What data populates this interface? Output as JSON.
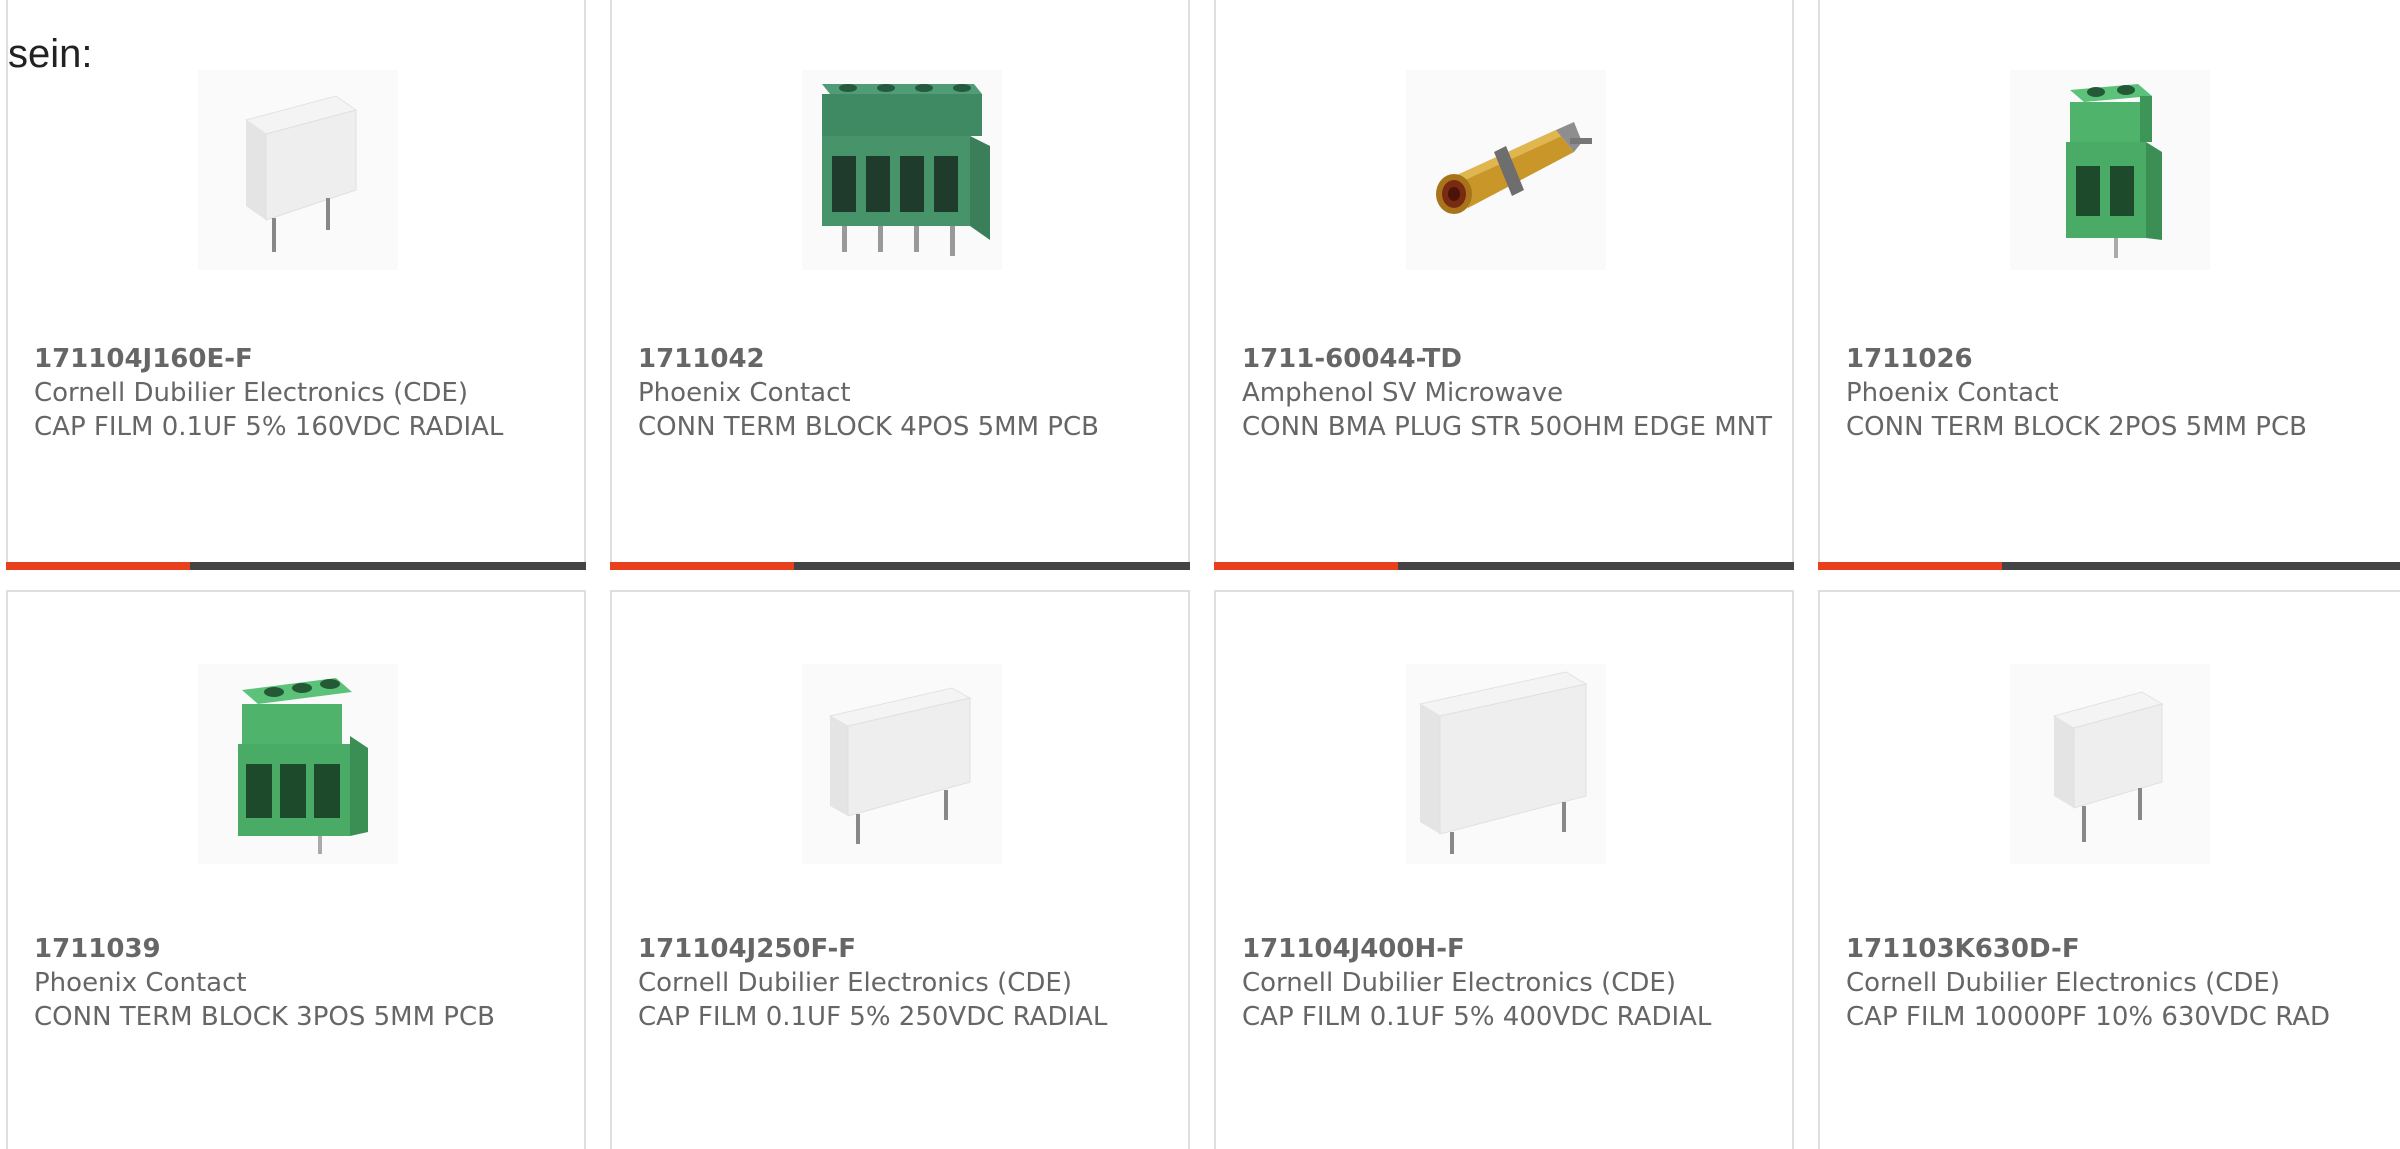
{
  "intro_text": "sein:",
  "colors": {
    "accent": "#e8401c",
    "bar_dark": "#444444",
    "card_border": "#dedede",
    "text": "#666666"
  },
  "products": [
    {
      "part_number": "171104J160E-F",
      "manufacturer": "Cornell Dubilier Electronics (CDE)",
      "description": "CAP FILM 0.1UF 5% 160VDC RADIAL",
      "image_icon": "film-capacitor-icon"
    },
    {
      "part_number": "1711042",
      "manufacturer": "Phoenix Contact",
      "description": "CONN TERM BLOCK 4POS 5MM PCB",
      "image_icon": "terminal-block-4pos-icon"
    },
    {
      "part_number": "1711-60044-TD",
      "manufacturer": "Amphenol SV Microwave",
      "description": "CONN BMA PLUG STR 50OHM EDGE MNT",
      "image_icon": "bma-plug-icon"
    },
    {
      "part_number": "1711026",
      "manufacturer": "Phoenix Contact",
      "description": "CONN TERM BLOCK 2POS 5MM PCB",
      "image_icon": "terminal-block-2pos-icon"
    },
    {
      "part_number": "1711039",
      "manufacturer": "Phoenix Contact",
      "description": "CONN TERM BLOCK 3POS 5MM PCB",
      "image_icon": "terminal-block-3pos-icon"
    },
    {
      "part_number": "171104J250F-F",
      "manufacturer": "Cornell Dubilier Electronics (CDE)",
      "description": "CAP FILM 0.1UF 5% 250VDC RADIAL",
      "image_icon": "film-capacitor-icon"
    },
    {
      "part_number": "171104J400H-F",
      "manufacturer": "Cornell Dubilier Electronics (CDE)",
      "description": "CAP FILM 0.1UF 5% 400VDC RADIAL",
      "image_icon": "film-capacitor-icon"
    },
    {
      "part_number": "171103K630D-F",
      "manufacturer": "Cornell Dubilier Electronics (CDE)",
      "description": "CAP FILM 10000PF 10% 630VDC RAD",
      "image_icon": "film-capacitor-icon"
    }
  ]
}
